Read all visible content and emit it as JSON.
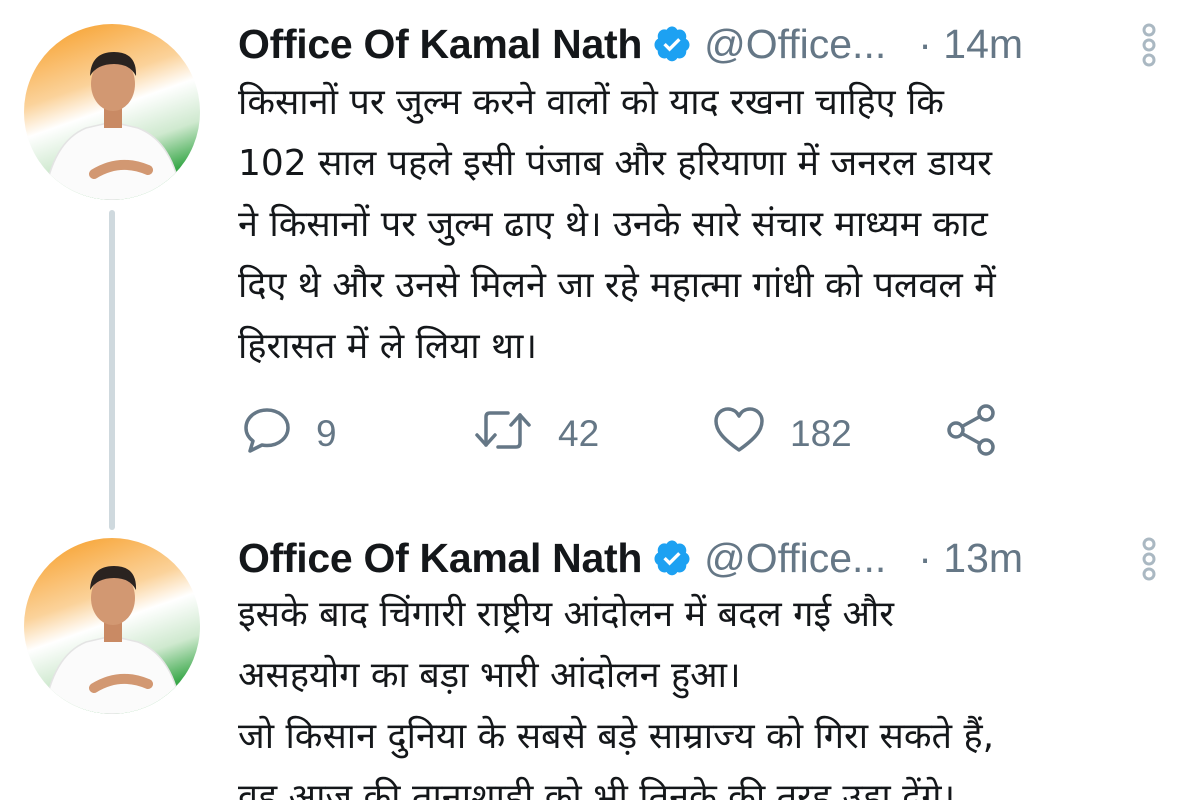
{
  "tweets": [
    {
      "author_name": "Office Of Kamal Nath",
      "handle": "@Office...",
      "time": "· 14m",
      "text": "किसानों पर जुल्म करने वालों को याद रखना चाहिए कि\n102 साल पहले इसी पंजाब और हरियाणा में जनरल डायर\nने किसानों पर जुल्म ढाए थे। उनके सारे संचार माध्यम काट\nदिए थे और उनसे मिलने जा रहे महात्मा गांधी को पलवल में\nहिरासत में ले लिया था।",
      "replies": "9",
      "retweets": "42",
      "likes": "182"
    },
    {
      "author_name": "Office Of Kamal Nath",
      "handle": "@Office...",
      "time": "· 13m",
      "text": "इसके बाद चिंगारी राष्ट्रीय आंदोलन में बदल गई और\nअसहयोग का बड़ा भारी आंदोलन हुआ।\nजो किसान दुनिया के सबसे बड़े साम्राज्य को गिरा सकते हैं,\nवह आज की तानाशाही को भी तिनके की तरह उड़ा देंगे।"
    }
  ],
  "icons": {
    "verified": "verified-badge-icon",
    "more": "more-vertical-icon",
    "reply": "comment-icon",
    "retweet": "retweet-icon",
    "like": "heart-icon",
    "share": "share-icon"
  },
  "colors": {
    "verified_blue": "#1da1f2",
    "meta_gray": "#657786",
    "thread_line": "#cfd9de",
    "saffron": "#f79a1f",
    "green": "#3aa84a"
  }
}
